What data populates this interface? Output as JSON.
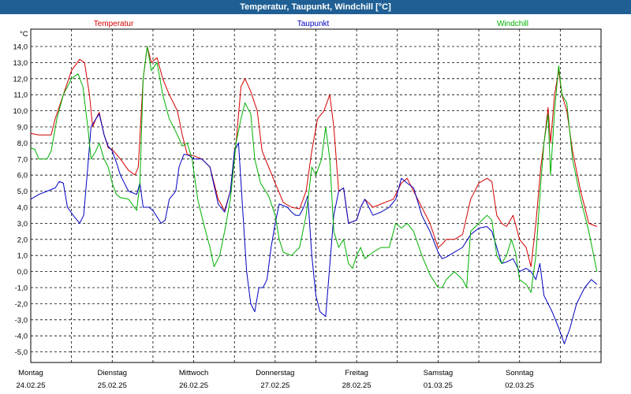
{
  "window": {
    "title": "Temperatur, Taupunkt, Windchill [°C]"
  },
  "colors": {
    "temperature": "#d40000",
    "dewpoint": "#0000c0",
    "windchill": "#00b000",
    "grid": "#000000",
    "titlebar": "#1f5f94"
  },
  "chart_data": {
    "type": "line",
    "title": "Temperatur, Taupunkt, Windchill [°C]",
    "ylabel": "°C",
    "ylim": [
      -5.5,
      15
    ],
    "yticks": [
      14.0,
      13.0,
      12.0,
      11.0,
      10.0,
      9.0,
      8.0,
      7.0,
      6.0,
      5.0,
      4.0,
      3.0,
      2.0,
      1.0,
      0.0,
      -1.0,
      -2.0,
      -3.0,
      -4.0,
      -5.0
    ],
    "ytick_labels": [
      "14,0",
      "13,0",
      "12,0",
      "11,0",
      "10,0",
      "9,0",
      "8,0",
      "7,0",
      "6,0",
      "5,0",
      "4,0",
      "3,0",
      "2,0",
      "1,0",
      "0,0",
      "-1,0",
      "-2,0",
      "-3,0",
      "-4,0",
      "-5,0"
    ],
    "xlim": [
      0,
      7
    ],
    "x_unit": "days from Montag 24.02.25 00:00",
    "xticks": [
      0,
      0.5,
      1,
      1.5,
      2,
      2.5,
      3,
      3.5,
      4,
      4.5,
      5,
      5.5,
      6,
      6.5,
      7
    ],
    "day_labels": [
      {
        "x": 0,
        "day": "Montag",
        "date": "24.02.25"
      },
      {
        "x": 1,
        "day": "Dienstag",
        "date": "25.02.25"
      },
      {
        "x": 2,
        "day": "Mittwoch",
        "date": "26.02.25"
      },
      {
        "x": 3,
        "day": "Donnerstag",
        "date": "27.02.25"
      },
      {
        "x": 4,
        "day": "Freitag",
        "date": "28.02.25"
      },
      {
        "x": 5,
        "day": "Samstag",
        "date": "01.03.25"
      },
      {
        "x": 6,
        "day": "Sonntag",
        "date": "02.03.25"
      }
    ],
    "grid": true,
    "series": [
      {
        "name": "Temperatur",
        "color": "#d40000",
        "points": [
          [
            0,
            8.6
          ],
          [
            0.1,
            8.5
          ],
          [
            0.25,
            8.5
          ],
          [
            0.3,
            9.5
          ],
          [
            0.4,
            11.0
          ],
          [
            0.5,
            12.5
          ],
          [
            0.6,
            13.2
          ],
          [
            0.66,
            13.0
          ],
          [
            0.72,
            11.0
          ],
          [
            0.76,
            9.0
          ],
          [
            0.8,
            9.5
          ],
          [
            0.84,
            9.9
          ],
          [
            0.9,
            8.5
          ],
          [
            0.95,
            7.7
          ],
          [
            1.0,
            7.6
          ],
          [
            1.1,
            7.0
          ],
          [
            1.2,
            6.3
          ],
          [
            1.28,
            6.0
          ],
          [
            1.32,
            6.5
          ],
          [
            1.38,
            12.0
          ],
          [
            1.43,
            14.0
          ],
          [
            1.48,
            13.0
          ],
          [
            1.55,
            13.3
          ],
          [
            1.62,
            12.0
          ],
          [
            1.7,
            11.0
          ],
          [
            1.8,
            10.0
          ],
          [
            1.86,
            8.5
          ],
          [
            1.92,
            7.3
          ],
          [
            2.0,
            7.2
          ],
          [
            2.1,
            7.0
          ],
          [
            2.2,
            6.5
          ],
          [
            2.3,
            4.5
          ],
          [
            2.38,
            3.8
          ],
          [
            2.45,
            5.0
          ],
          [
            2.52,
            8.0
          ],
          [
            2.58,
            11.5
          ],
          [
            2.63,
            12.0
          ],
          [
            2.7,
            11.2
          ],
          [
            2.78,
            10.0
          ],
          [
            2.84,
            7.5
          ],
          [
            2.92,
            6.5
          ],
          [
            3.0,
            5.5
          ],
          [
            3.1,
            4.3
          ],
          [
            3.2,
            4.0
          ],
          [
            3.3,
            3.9
          ],
          [
            3.38,
            5.0
          ],
          [
            3.45,
            7.5
          ],
          [
            3.52,
            9.5
          ],
          [
            3.6,
            10.0
          ],
          [
            3.67,
            11.0
          ],
          [
            3.72,
            9.0
          ],
          [
            3.78,
            5.0
          ],
          [
            3.84,
            5.2
          ],
          [
            3.9,
            3.0
          ],
          [
            4.0,
            3.2
          ],
          [
            4.05,
            4.0
          ],
          [
            4.1,
            4.5
          ],
          [
            4.2,
            4.0
          ],
          [
            4.3,
            4.2
          ],
          [
            4.45,
            4.5
          ],
          [
            4.55,
            5.5
          ],
          [
            4.62,
            5.8
          ],
          [
            4.7,
            5.0
          ],
          [
            4.8,
            4.0
          ],
          [
            4.9,
            3.0
          ],
          [
            5.0,
            1.5
          ],
          [
            5.05,
            1.7
          ],
          [
            5.1,
            2.0
          ],
          [
            5.2,
            2.0
          ],
          [
            5.3,
            2.3
          ],
          [
            5.4,
            4.5
          ],
          [
            5.5,
            5.5
          ],
          [
            5.6,
            5.8
          ],
          [
            5.66,
            5.6
          ],
          [
            5.72,
            3.5
          ],
          [
            5.78,
            3.0
          ],
          [
            5.84,
            2.8
          ],
          [
            5.92,
            3.5
          ],
          [
            6.0,
            2.0
          ],
          [
            6.08,
            1.5
          ],
          [
            6.14,
            0.3
          ],
          [
            6.2,
            3.0
          ],
          [
            6.26,
            6.5
          ],
          [
            6.3,
            8.0
          ],
          [
            6.35,
            10.2
          ],
          [
            6.38,
            8.0
          ],
          [
            6.43,
            11.0
          ],
          [
            6.48,
            12.5
          ],
          [
            6.52,
            11.0
          ],
          [
            6.58,
            10.0
          ],
          [
            6.65,
            7.5
          ],
          [
            6.75,
            5.0
          ],
          [
            6.85,
            3.0
          ],
          [
            6.95,
            2.8
          ]
        ]
      },
      {
        "name": "Taupunkt",
        "color": "#0000c0",
        "points": [
          [
            0,
            4.5
          ],
          [
            0.1,
            4.8
          ],
          [
            0.2,
            5.0
          ],
          [
            0.3,
            5.2
          ],
          [
            0.35,
            5.6
          ],
          [
            0.4,
            5.5
          ],
          [
            0.45,
            4.0
          ],
          [
            0.52,
            3.5
          ],
          [
            0.6,
            3.0
          ],
          [
            0.65,
            3.5
          ],
          [
            0.7,
            6.5
          ],
          [
            0.74,
            9.0
          ],
          [
            0.8,
            9.5
          ],
          [
            0.84,
            9.8
          ],
          [
            0.9,
            8.5
          ],
          [
            0.95,
            7.8
          ],
          [
            1.0,
            7.5
          ],
          [
            1.05,
            6.8
          ],
          [
            1.1,
            6.0
          ],
          [
            1.2,
            5.0
          ],
          [
            1.3,
            4.8
          ],
          [
            1.34,
            5.5
          ],
          [
            1.38,
            4.0
          ],
          [
            1.45,
            4.0
          ],
          [
            1.5,
            3.8
          ],
          [
            1.6,
            3.0
          ],
          [
            1.65,
            3.2
          ],
          [
            1.7,
            4.5
          ],
          [
            1.78,
            5.0
          ],
          [
            1.82,
            6.5
          ],
          [
            1.88,
            7.3
          ],
          [
            1.95,
            7.2
          ],
          [
            2.0,
            7.0
          ],
          [
            2.1,
            7.0
          ],
          [
            2.2,
            6.5
          ],
          [
            2.3,
            4.2
          ],
          [
            2.38,
            3.7
          ],
          [
            2.45,
            5.0
          ],
          [
            2.5,
            7.5
          ],
          [
            2.55,
            8.0
          ],
          [
            2.6,
            4.0
          ],
          [
            2.65,
            0.0
          ],
          [
            2.7,
            -2.0
          ],
          [
            2.75,
            -2.5
          ],
          [
            2.8,
            -1.0
          ],
          [
            2.85,
            -1.0
          ],
          [
            2.9,
            -0.5
          ],
          [
            2.95,
            1.5
          ],
          [
            3.0,
            3.0
          ],
          [
            3.05,
            4.2
          ],
          [
            3.15,
            4.0
          ],
          [
            3.2,
            3.7
          ],
          [
            3.25,
            3.5
          ],
          [
            3.3,
            3.5
          ],
          [
            3.35,
            4.0
          ],
          [
            3.4,
            4.7
          ],
          [
            3.45,
            1.0
          ],
          [
            3.5,
            -1.5
          ],
          [
            3.55,
            -2.5
          ],
          [
            3.62,
            -2.8
          ],
          [
            3.68,
            1.0
          ],
          [
            3.72,
            3.5
          ],
          [
            3.78,
            5.0
          ],
          [
            3.84,
            5.2
          ],
          [
            3.9,
            3.0
          ],
          [
            4.0,
            3.2
          ],
          [
            4.05,
            4.0
          ],
          [
            4.1,
            4.5
          ],
          [
            4.2,
            3.5
          ],
          [
            4.3,
            3.7
          ],
          [
            4.4,
            4.0
          ],
          [
            4.48,
            4.5
          ],
          [
            4.55,
            5.8
          ],
          [
            4.62,
            5.5
          ],
          [
            4.7,
            5.2
          ],
          [
            4.8,
            3.5
          ],
          [
            4.9,
            2.5
          ],
          [
            5.0,
            1.2
          ],
          [
            5.05,
            0.8
          ],
          [
            5.1,
            0.9
          ],
          [
            5.2,
            1.2
          ],
          [
            5.3,
            1.5
          ],
          [
            5.4,
            2.3
          ],
          [
            5.5,
            2.7
          ],
          [
            5.6,
            2.8
          ],
          [
            5.66,
            2.5
          ],
          [
            5.72,
            1.5
          ],
          [
            5.78,
            0.5
          ],
          [
            5.84,
            0.6
          ],
          [
            5.92,
            0.8
          ],
          [
            6.0,
            0.0
          ],
          [
            6.08,
            0.2
          ],
          [
            6.14,
            0.0
          ],
          [
            6.2,
            -0.5
          ],
          [
            6.25,
            0.5
          ],
          [
            6.3,
            -1.5
          ],
          [
            6.4,
            -2.5
          ],
          [
            6.48,
            -3.5
          ],
          [
            6.55,
            -4.5
          ],
          [
            6.62,
            -3.5
          ],
          [
            6.7,
            -2.0
          ],
          [
            6.8,
            -1.0
          ],
          [
            6.88,
            -0.5
          ],
          [
            6.95,
            -0.8
          ]
        ]
      },
      {
        "name": "Windchill",
        "color": "#00b000",
        "points": [
          [
            0,
            7.7
          ],
          [
            0.05,
            7.6
          ],
          [
            0.1,
            7.0
          ],
          [
            0.2,
            7.0
          ],
          [
            0.25,
            7.5
          ],
          [
            0.32,
            9.5
          ],
          [
            0.4,
            11.0
          ],
          [
            0.5,
            12.0
          ],
          [
            0.58,
            12.3
          ],
          [
            0.64,
            11.5
          ],
          [
            0.7,
            9.0
          ],
          [
            0.74,
            7.0
          ],
          [
            0.8,
            7.5
          ],
          [
            0.84,
            8.0
          ],
          [
            0.9,
            7.0
          ],
          [
            0.95,
            6.5
          ],
          [
            1.0,
            5.5
          ],
          [
            1.05,
            4.8
          ],
          [
            1.1,
            4.6
          ],
          [
            1.2,
            4.5
          ],
          [
            1.3,
            3.8
          ],
          [
            1.34,
            5.5
          ],
          [
            1.38,
            12.0
          ],
          [
            1.43,
            14.0
          ],
          [
            1.48,
            12.5
          ],
          [
            1.55,
            13.0
          ],
          [
            1.62,
            11.0
          ],
          [
            1.7,
            9.5
          ],
          [
            1.8,
            8.5
          ],
          [
            1.86,
            7.8
          ],
          [
            1.92,
            8.0
          ],
          [
            1.98,
            7.0
          ],
          [
            2.05,
            4.5
          ],
          [
            2.12,
            3.0
          ],
          [
            2.2,
            1.5
          ],
          [
            2.25,
            0.3
          ],
          [
            2.32,
            1.0
          ],
          [
            2.38,
            2.5
          ],
          [
            2.45,
            4.5
          ],
          [
            2.52,
            8.0
          ],
          [
            2.58,
            9.5
          ],
          [
            2.63,
            10.5
          ],
          [
            2.7,
            9.8
          ],
          [
            2.75,
            7.0
          ],
          [
            2.82,
            5.5
          ],
          [
            2.92,
            4.7
          ],
          [
            3.0,
            3.5
          ],
          [
            3.05,
            2.0
          ],
          [
            3.1,
            1.2
          ],
          [
            3.2,
            1.0
          ],
          [
            3.3,
            1.5
          ],
          [
            3.38,
            3.5
          ],
          [
            3.45,
            6.5
          ],
          [
            3.5,
            6.0
          ],
          [
            3.57,
            7.0
          ],
          [
            3.62,
            9.0
          ],
          [
            3.67,
            7.0
          ],
          [
            3.72,
            2.5
          ],
          [
            3.78,
            1.5
          ],
          [
            3.84,
            2.0
          ],
          [
            3.9,
            0.5
          ],
          [
            3.95,
            0.2
          ],
          [
            4.0,
            1.0
          ],
          [
            4.05,
            1.5
          ],
          [
            4.1,
            0.8
          ],
          [
            4.2,
            1.2
          ],
          [
            4.3,
            1.5
          ],
          [
            4.4,
            1.5
          ],
          [
            4.48,
            3.0
          ],
          [
            4.55,
            2.7
          ],
          [
            4.62,
            3.0
          ],
          [
            4.7,
            2.5
          ],
          [
            4.8,
            1.0
          ],
          [
            4.9,
            -0.2
          ],
          [
            5.0,
            -1.0
          ],
          [
            5.05,
            -1.0
          ],
          [
            5.1,
            -0.5
          ],
          [
            5.2,
            0.0
          ],
          [
            5.3,
            -0.5
          ],
          [
            5.35,
            -1.0
          ],
          [
            5.4,
            2.5
          ],
          [
            5.5,
            3.0
          ],
          [
            5.6,
            3.5
          ],
          [
            5.66,
            3.2
          ],
          [
            5.72,
            1.0
          ],
          [
            5.78,
            0.5
          ],
          [
            5.84,
            1.0
          ],
          [
            5.9,
            2.0
          ],
          [
            5.95,
            1.2
          ],
          [
            6.0,
            -0.5
          ],
          [
            6.08,
            -0.8
          ],
          [
            6.14,
            -1.3
          ],
          [
            6.2,
            1.0
          ],
          [
            6.26,
            5.5
          ],
          [
            6.3,
            8.0
          ],
          [
            6.35,
            9.8
          ],
          [
            6.38,
            6.0
          ],
          [
            6.43,
            10.0
          ],
          [
            6.48,
            12.8
          ],
          [
            6.52,
            11.0
          ],
          [
            6.58,
            10.5
          ],
          [
            6.65,
            7.0
          ],
          [
            6.75,
            4.5
          ],
          [
            6.85,
            2.5
          ],
          [
            6.95,
            0.0
          ]
        ]
      }
    ]
  }
}
